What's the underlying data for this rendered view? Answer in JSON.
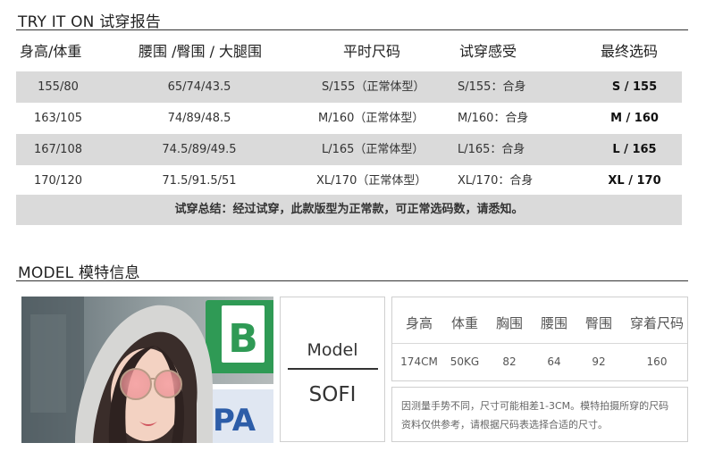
{
  "try_on": {
    "title": "TRY IT ON 试穿报告",
    "headers": [
      "身高/体重",
      "腰围 /臀围 / 大腿围",
      "平时尺码",
      "试穿感受",
      "最终选码"
    ],
    "rows": [
      {
        "hw": "155/80",
        "measure": "65/74/43.5",
        "usual": "S/155（正常体型）",
        "feel": "S/155：合身",
        "final": "S / 155"
      },
      {
        "hw": "163/105",
        "measure": "74/89/48.5",
        "usual": "M/160（正常体型）",
        "feel": "M/160：合身",
        "final": "M / 160"
      },
      {
        "hw": "167/108",
        "measure": "74.5/89/49.5",
        "usual": "L/165（正常体型）",
        "feel": "L/165：合身",
        "final": "L / 165"
      },
      {
        "hw": "170/120",
        "measure": "71.5/91.5/51",
        "usual": "XL/170（正常体型）",
        "feel": "XL/170：合身",
        "final": "XL / 170"
      }
    ],
    "summary": "试穿总结：经过试穿，此款版型为正常款，可正常选码数，请悉知。"
  },
  "model": {
    "title": "MODEL 模特信息",
    "label": "Model",
    "name": "SOFI",
    "headers": [
      "身高",
      "体重",
      "胸围",
      "腰围",
      "臀围",
      "穿着尺码"
    ],
    "values": [
      "174CM",
      "50KG",
      "82",
      "64",
      "92",
      "160"
    ],
    "note": "因测量手势不同，尺寸可能相差1-3CM。模特拍摄所穿的尺码资料仅供参考，请根据尺码表选择合适的尺寸。",
    "photo_sign_letters": [
      "B",
      "PA"
    ]
  }
}
